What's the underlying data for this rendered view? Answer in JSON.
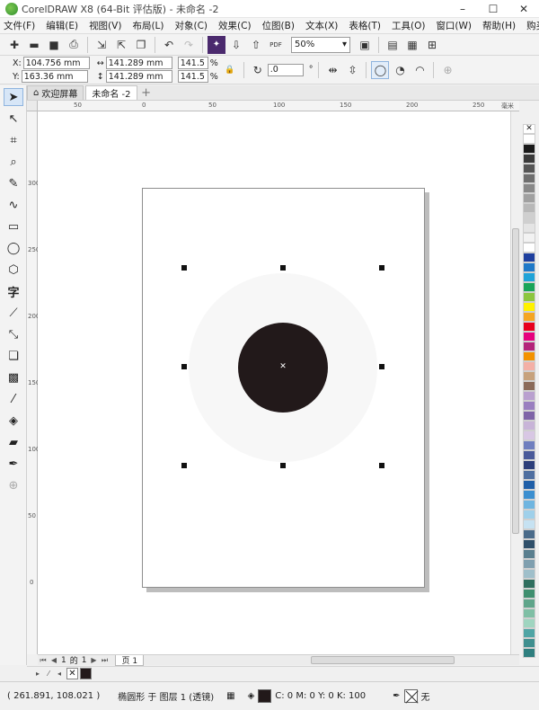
{
  "window": {
    "title": "CorelDRAW X8 (64-Bit 评估版) - 未命名 -2",
    "controls": [
      "–",
      "☐",
      "✕"
    ]
  },
  "menu": {
    "items": [
      "文件(F)",
      "编辑(E)",
      "视图(V)",
      "布局(L)",
      "对象(C)",
      "效果(C)",
      "位图(B)",
      "文本(X)",
      "表格(T)",
      "工具(O)",
      "窗口(W)",
      "帮助(H)",
      "购买"
    ]
  },
  "standard_toolbar": {
    "icons": [
      "new-icon",
      "open-icon",
      "save-icon",
      "print-icon",
      "import-icon",
      "export-icon",
      "publish-pdf-icon",
      "undo-icon",
      "redo-icon",
      "snap-icon",
      "fullscreen-icon"
    ],
    "pdf_label": "PDF",
    "zoom_value": "50%"
  },
  "property_bar": {
    "x_label": "X:",
    "x_value": "104.756 mm",
    "y_label": "Y:",
    "y_value": "163.36 mm",
    "width_value": "141.289 mm",
    "height_value": "141.289 mm",
    "scale_w": "141.5",
    "scale_h": "141.5",
    "percent": "%",
    "rotation_value": ".0",
    "degree": "°"
  },
  "tabs": {
    "welcome": "欢迎屏幕",
    "document": "未命名 -2",
    "add": "+"
  },
  "rulers": {
    "unit": "毫米",
    "h_labels": [
      "50",
      "0",
      "50",
      "100",
      "150",
      "200",
      "250"
    ],
    "v_labels": [
      "300",
      "250",
      "200",
      "150",
      "100",
      "50",
      "0"
    ]
  },
  "navigator": {
    "page_current": "1",
    "page_of": "的",
    "page_total": "1",
    "page_tab": "页 1"
  },
  "status": {
    "coordinates": "( 261.891, 108.021 )",
    "object_info": "椭圆形 于 图层 1 (透镜)",
    "fill_info": "C: 0 M: 0 Y: 0 K: 100",
    "outline_info": "无"
  },
  "colors": {
    "object_fill": "#22191a",
    "halo": "#f7f7f7",
    "palette": [
      "#ffffff",
      "#1a1a1a",
      "#3a3a3a",
      "#555555",
      "#6e6e6e",
      "#888888",
      "#a0a0a0",
      "#b8b8b8",
      "#cfcfcf",
      "#e4e4e4",
      "#f2f2f2",
      "#ffffff",
      "#1e3f9e",
      "#1f79c8",
      "#1fa3d8",
      "#19a55a",
      "#8cc63f",
      "#fff200",
      "#f5a623",
      "#e8001d",
      "#e6007e",
      "#b4237a",
      "#f39200",
      "#f4b0a6",
      "#c7a27c",
      "#8b6b5a",
      "#b9a0cf",
      "#9a7fc0",
      "#7f64a8",
      "#c8b4d8",
      "#d8c7e4",
      "#6f7fbf",
      "#4a5a9a",
      "#2c3e7a",
      "#4f6fa0",
      "#1f5fa8",
      "#3c8fd0",
      "#6fb5e0",
      "#9fd0ea",
      "#c6e2f2",
      "#4a6b8a",
      "#2f4f6a",
      "#5a7f8f",
      "#7f9faf",
      "#9fbfca",
      "#2f6f5f",
      "#3f8f6f",
      "#5fa58a",
      "#7fbfa5",
      "#9fd5c0",
      "#4fa5a5",
      "#3f8f8f",
      "#2f7f7f"
    ]
  }
}
